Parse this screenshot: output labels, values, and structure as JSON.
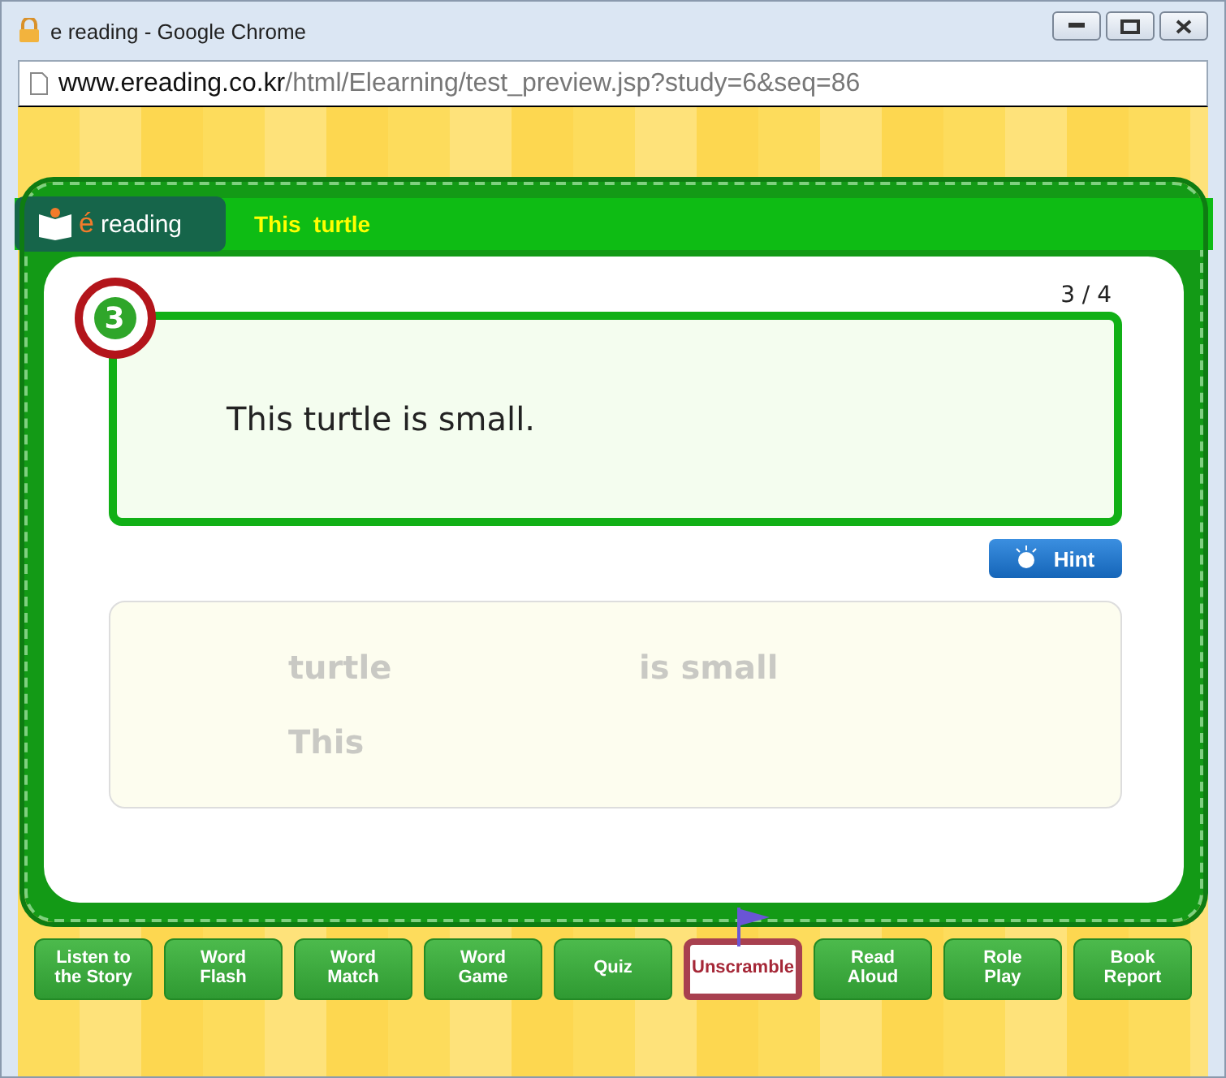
{
  "window": {
    "title": "e reading - Google Chrome"
  },
  "address": {
    "host": "www.ereading.co.kr",
    "path": "/html/Elearning/test_preview.jsp?study=6&seq=86"
  },
  "logo": {
    "accent": "é",
    "text": "reading"
  },
  "lesson_title": "This  turtle",
  "question": {
    "number": "3",
    "progress": "3 / 4",
    "sentence": "This turtle is small."
  },
  "hint_button": "Hint",
  "word_tiles": [
    {
      "text": "turtle"
    },
    {
      "text": "is small"
    },
    {
      "text": "This"
    }
  ],
  "tabs": [
    {
      "label": "Listen to\nthe Story",
      "selected": false
    },
    {
      "label": "Word\nFlash",
      "selected": false
    },
    {
      "label": "Word\nMatch",
      "selected": false
    },
    {
      "label": "Word\nGame",
      "selected": false
    },
    {
      "label": "Quiz",
      "selected": false
    },
    {
      "label": "Unscramble",
      "selected": true
    },
    {
      "label": "Read\nAloud",
      "selected": false
    },
    {
      "label": "Role\nPlay",
      "selected": false
    },
    {
      "label": "Book\nReport",
      "selected": false
    }
  ]
}
